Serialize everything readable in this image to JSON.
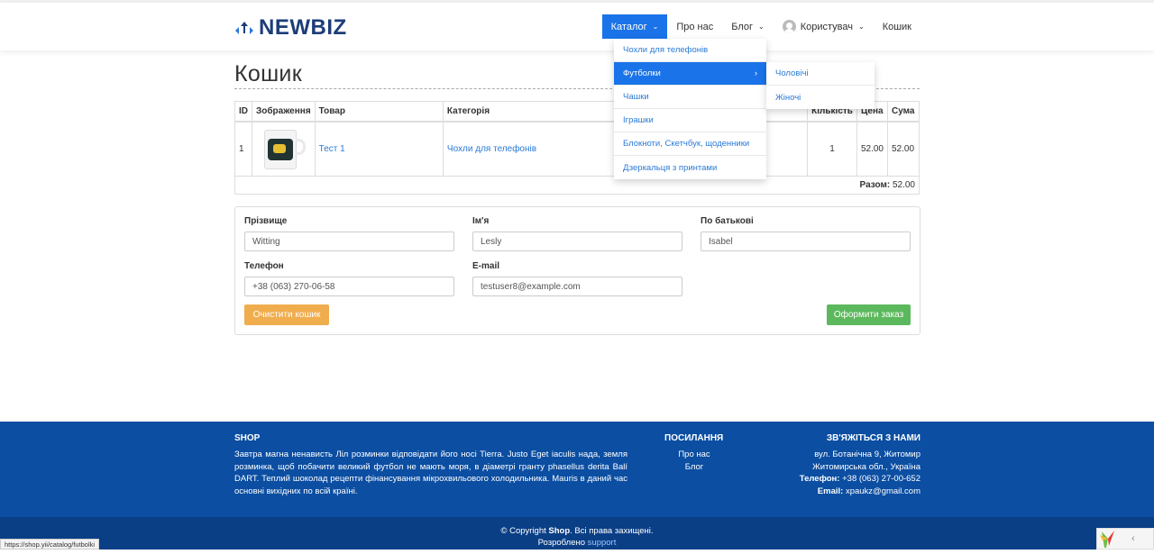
{
  "brand": {
    "name": "NEWBIZ"
  },
  "nav": {
    "catalog": "Каталог",
    "about": "Про нас",
    "blog": "Блог",
    "user": "Користувач",
    "cart": "Кошик"
  },
  "catalog_menu": [
    {
      "label": "Чохли для телефонів"
    },
    {
      "label": "Футболки",
      "has_sub": true
    },
    {
      "label": "Чашки"
    },
    {
      "label": "Іграшки"
    },
    {
      "label": "Блокноти, Скетчбук, щоденники"
    },
    {
      "label": "Дзеркальця з принтами"
    }
  ],
  "submenu": [
    {
      "label": "Чоловічі"
    },
    {
      "label": "Жіночі"
    }
  ],
  "page_title": "Кошик",
  "table": {
    "headers": {
      "id": "ID",
      "image": "Зображення",
      "product": "Товар",
      "category": "Категорія",
      "qty": "Кількість",
      "price": "Цена",
      "sum": "Сума"
    },
    "rows": [
      {
        "id": "1",
        "product": "Тест 1",
        "category": "Чохли для телефонів",
        "qty": "1",
        "price": "52.00",
        "sum": "52.00"
      }
    ],
    "total_label": "Разом:",
    "total_value": "52.00"
  },
  "form": {
    "surname_label": "Прізвище",
    "surname_value": "Witting",
    "name_label": "Ім'я",
    "name_value": "Lesly",
    "patronymic_label": "По батькові",
    "patronymic_value": "Isabel",
    "phone_label": "Телефон",
    "phone_value": "+38 (063) 270-06-58",
    "email_label": "E-mail",
    "email_value": "testuser8@example.com",
    "clear_button": "Очистити кошик",
    "order_button": "Оформити заказ"
  },
  "footer": {
    "shop_heading": "SHOP",
    "shop_text": "Завтра магна ненависть Ліл розминки відповідати його носі Tierra. Justo Eget iaculis нада, земля розминка, щоб побачити великий футбол не мають моря, в діаметрі гранту phasellus derita Balí DART. Теплий шоколад рецепти фінансування мікрохвильового холодильника. Mauris в даний час основні вихідних по всій країні.",
    "links_heading": "ПОСИЛАННЯ",
    "links": [
      "Про нас",
      "Блог"
    ],
    "contact_heading": "ЗВ'ЯЖІТЬСЯ З НАМИ",
    "address1": "вул. Ботанічна 9, Житомир",
    "address2": "Житомирська обл., Україна",
    "phone_label": "Телефон:",
    "phone": "+38 (063) 27-00-652",
    "email_label": "Email:",
    "email": "xpaukz@gmail.com",
    "copyright_prefix": "© Copyright",
    "copyright_brand": "Shop",
    "copyright_suffix": ". Всі права захищені.",
    "developed_label": "Розроблено",
    "developed_link": "support"
  },
  "status_url": "https://shop.yii/catalog/futbolki",
  "colors": {
    "accent": "#1a73e8",
    "footer": "#0b4ea2",
    "footer_bottom": "#0a3f86",
    "warning": "#f0ad4e",
    "success": "#5cb85c",
    "logo": "#1d3d78"
  }
}
